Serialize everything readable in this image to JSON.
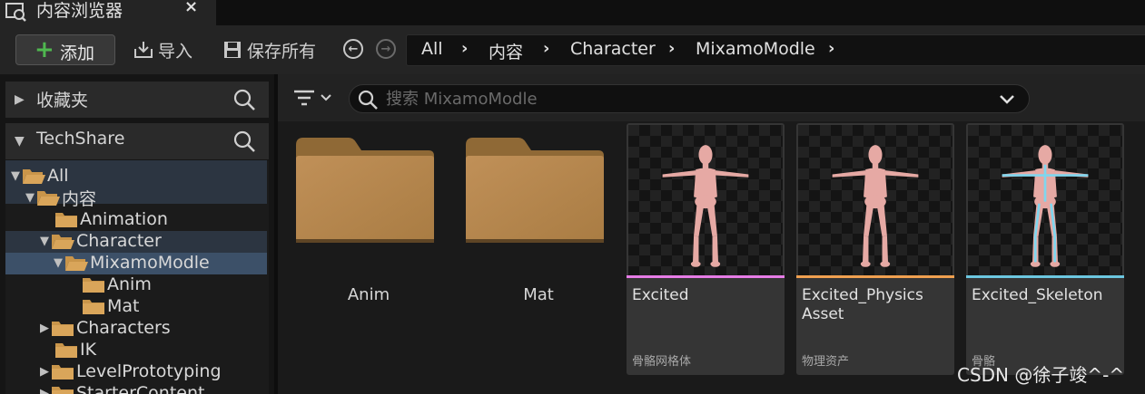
{
  "tab": {
    "title": "内容浏览器",
    "close": "×",
    "icon": "content-browser-icon"
  },
  "toolbar": {
    "add_label": "添加",
    "import_label": "导入",
    "save_all_label": "保存所有",
    "back_icon": "back-arrow-icon",
    "forward_icon": "forward-arrow-icon"
  },
  "breadcrumb": [
    "All",
    "内容",
    "Character",
    "MixamoModle"
  ],
  "left_panel": {
    "favorites_label": "收藏夹",
    "project_label": "TechShare",
    "tree": [
      {
        "label": "All",
        "depth": 0,
        "expanded": true
      },
      {
        "label": "内容",
        "depth": 1,
        "expanded": true
      },
      {
        "label": "Animation",
        "depth": 2
      },
      {
        "label": "Character",
        "depth": 2,
        "expanded": true
      },
      {
        "label": "MixamoModle",
        "depth": 3,
        "expanded": true,
        "selected": true
      },
      {
        "label": "Anim",
        "depth": 4
      },
      {
        "label": "Mat",
        "depth": 4
      },
      {
        "label": "Characters",
        "depth": 2,
        "collapsed": true
      },
      {
        "label": "IK",
        "depth": 2
      },
      {
        "label": "LevelPrototyping",
        "depth": 2,
        "collapsed": true
      },
      {
        "label": "StarterContent",
        "depth": 2,
        "collapsed": true
      }
    ]
  },
  "search": {
    "placeholder": "搜索 MixamoModle"
  },
  "content": {
    "folders": [
      {
        "label": "Anim"
      },
      {
        "label": "Mat"
      }
    ],
    "assets": [
      {
        "name": "Excited",
        "type": "骨骼网格体",
        "color": "#e67ce6"
      },
      {
        "name": "Excited_Physics Asset",
        "type": "物理资产",
        "color": "#f0a050"
      },
      {
        "name": "Excited_Skeleton",
        "type": "骨骼",
        "color": "#6cc7e0"
      }
    ]
  },
  "watermark": "CSDN @徐子竣^-^"
}
